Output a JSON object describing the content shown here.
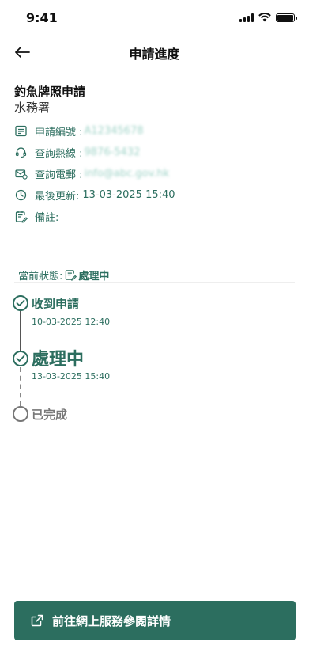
{
  "status_bar": {
    "time": "9:41"
  },
  "header": {
    "title": "申請進度"
  },
  "application": {
    "name": "釣魚牌照申請",
    "department": "水務署",
    "fields": [
      {
        "icon": "document-number-icon",
        "label": "申請編號 :",
        "value": "A12345678"
      },
      {
        "icon": "headset-icon",
        "label": "查詢熱線 :",
        "value": "9876-5432"
      },
      {
        "icon": "email-icon",
        "label": "查詢電郵 :",
        "value": "info@abc.gov.hk"
      },
      {
        "icon": "clock-icon",
        "label": "最後更新:",
        "value": "13-03-2025 15:40"
      },
      {
        "icon": "note-edit-icon",
        "label": "備註:",
        "value": ""
      }
    ]
  },
  "current_status": {
    "label": "當前狀態:",
    "value": "處理中"
  },
  "timeline": {
    "steps": [
      {
        "label": "收到申請",
        "date": "10-03-2025 12:40",
        "state": "done"
      },
      {
        "label": "處理中",
        "date": "13-03-2025 15:40",
        "state": "current"
      },
      {
        "label": "已完成",
        "date": "",
        "state": "pending"
      }
    ]
  },
  "action": {
    "label": "前往網上服務參閱詳情"
  },
  "colors": {
    "brand": "#2c6e5f",
    "blurred_text": "#9fd3c7",
    "pending": "#777777"
  }
}
